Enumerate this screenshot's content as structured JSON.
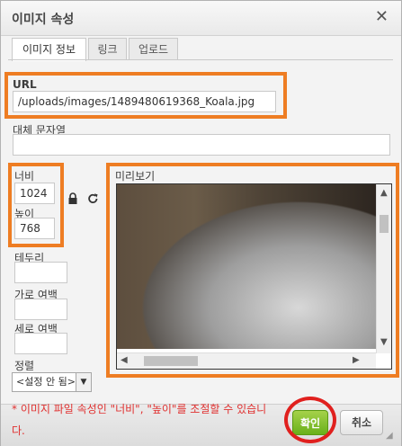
{
  "dialog": {
    "title": "이미지 속성",
    "close_symbol": "✕"
  },
  "tabs": [
    {
      "label": "이미지 정보",
      "active": true
    },
    {
      "label": "링크",
      "active": false
    },
    {
      "label": "업로드",
      "active": false
    }
  ],
  "fields": {
    "url_label": "URL",
    "url_value": "/uploads/images/1489480619368_Koala.jpg",
    "alt_label": "대체 문자열",
    "width_label": "너비",
    "width_value": "1024",
    "height_label": "높이",
    "height_value": "768",
    "border_label": "테두리",
    "hspace_label": "가로 여백",
    "vspace_label": "세로 여백",
    "align_label": "정렬",
    "align_value": "<설정 안 됨>"
  },
  "preview": {
    "label": "미리보기"
  },
  "icons": {
    "lock": "lock-icon",
    "reset": "refresh-icon"
  },
  "note": "* 이미지 파일 속성인 \"너비\", \"높이\"를 조절할 수 있습니다.",
  "footer": {
    "ok_label": "확인",
    "cancel_label": "취소"
  },
  "colors": {
    "highlight_box": "#ee7d23",
    "highlight_circle": "#e0201e",
    "ok_button": "#69b01a",
    "note_text": "#e0302f"
  }
}
